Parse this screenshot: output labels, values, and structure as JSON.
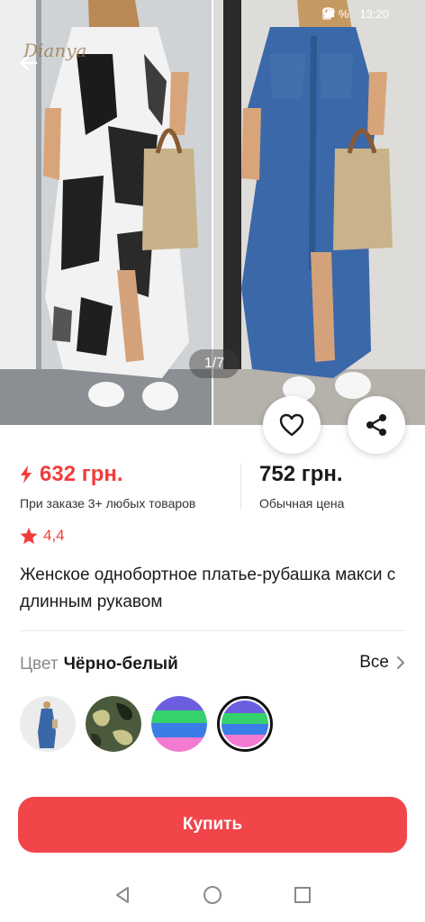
{
  "status": {
    "battery": "%",
    "time": "13:20"
  },
  "hero": {
    "watermark": "Dianya",
    "counter": "1/7"
  },
  "price": {
    "promo_value": "632 грн.",
    "promo_condition": "При заказе 3+ любых товаров",
    "regular_value": "752 грн.",
    "regular_label": "Обычная цена",
    "accent_color": "#f23c3c"
  },
  "rating": {
    "value": "4,4",
    "icon": "star-icon"
  },
  "product": {
    "title": "Женское однобортное платье-рубашка макси с длинным рукавом"
  },
  "color": {
    "label": "Цвет",
    "selected": "Чёрно-белый",
    "all_label": "Все",
    "swatches": [
      {
        "name": "denim-blue",
        "selected": false
      },
      {
        "name": "camouflage",
        "selected": false
      },
      {
        "name": "stripes-multicolor",
        "selected": false
      },
      {
        "name": "stripes-multicolor-alt",
        "selected": true
      }
    ]
  },
  "actions": {
    "buy_label": "Купить",
    "buy_color": "#f2454a"
  },
  "navbar": {
    "icons": [
      "back-triangle-icon",
      "home-circle-icon",
      "recents-square-icon"
    ]
  }
}
